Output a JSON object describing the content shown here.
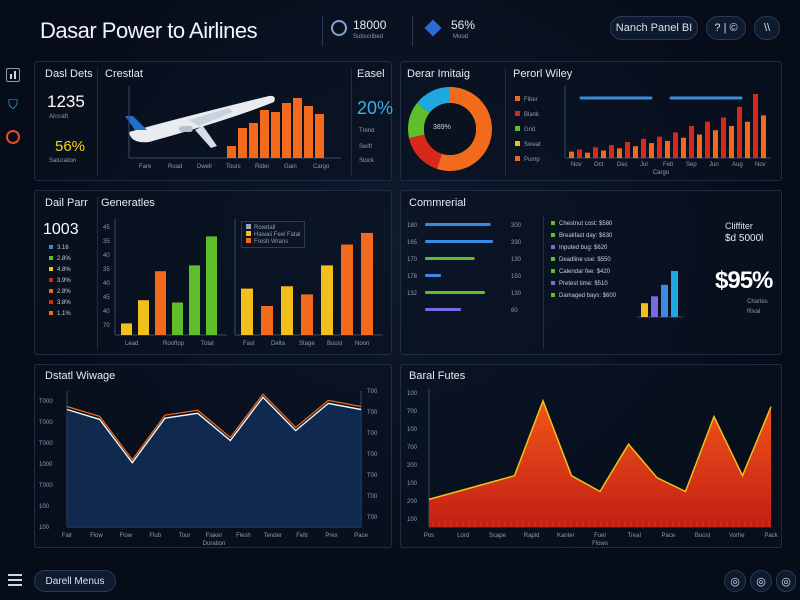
{
  "header": {
    "title": "Dasar Power to Airlines",
    "stat1": {
      "value": "18000",
      "label": "Subscribed"
    },
    "stat2": {
      "value": "56%",
      "label": "Mood"
    },
    "profile_button": "Nanch Panel BI",
    "help_button": "? | ©",
    "exit_button": "\\\\"
  },
  "sidebar": {
    "icons": [
      "chart-icon",
      "shield-icon",
      "gauge-icon"
    ],
    "bottom_icon": "menu-icon"
  },
  "panel_deal_dets": {
    "title": "Dasl Dets",
    "kpi1_value": "1235",
    "kpi1_label": "Aircraft",
    "kpi2_value": "56%",
    "kpi2_label": "Saturation",
    "chart_title": "Crestlat",
    "right_title": "Easel",
    "right_value": "20%",
    "right_items": [
      "Trend",
      "Swift",
      "Stock"
    ],
    "x_labels": [
      "Fare",
      "Road",
      "Dwell",
      "Tours",
      "Rider",
      "Gain",
      "Cargo"
    ]
  },
  "panel_donut": {
    "title": "Derar Imitaig",
    "center_value": "389%"
  },
  "panel_power": {
    "title": "Perorl Wiley",
    "legend": [
      "Fiber",
      "Blank",
      "Grid",
      "Sweat",
      "Pump"
    ],
    "x_labels": [
      "Nov",
      "Oct",
      "Dec",
      "Jul",
      "Feb",
      "Sep",
      "Jun",
      "Aug",
      "Nov"
    ],
    "axis_label": "Cargo"
  },
  "panel_dial_parr": {
    "title": "Dail Parr",
    "value": "1003",
    "items": [
      "3.16",
      "2.8%",
      "4.8%",
      "3.9%",
      "2.8%",
      "3.8%",
      "1.1%"
    ]
  },
  "panel_generators": {
    "title": "Generatles",
    "y_labels": [
      "45",
      "35",
      "40",
      "35",
      "40",
      "45",
      "40",
      "70"
    ],
    "x_labels": [
      "Lead",
      "Rooftop",
      "Total"
    ],
    "legend": [
      "Rowdall",
      "Hawaii Feel Fatal",
      "Fresh Wrans"
    ],
    "x_labels2": [
      "Fast",
      "Delta",
      "Stage",
      "Boost",
      "Noon"
    ]
  },
  "panel_commercial": {
    "title": "Commrerial",
    "bars_labels": [
      "180",
      "165",
      "170",
      "178",
      "132"
    ],
    "bar_values": [
      "300",
      "330",
      "130",
      "150",
      "130",
      "60"
    ],
    "list": [
      "Chestnut cost: $580",
      "Breakfast day: $630",
      "Inputed bug: $620",
      "Deadline use: $550",
      "Calendar fee: $420",
      "Pretest time: $510",
      "Damaged bays: $600"
    ],
    "value_label": "Cliffiter",
    "value_amount": "$d 5000l",
    "big_percent": "$95%",
    "big_sub1": "Charles",
    "big_sub2": "Rival"
  },
  "panel_wave": {
    "title": "Dstatl Wiwage",
    "y_left": [
      "T000",
      "T000",
      "T000",
      "1000",
      "T000",
      "100",
      "100"
    ],
    "y_right": [
      "T00",
      "T00",
      "T00",
      "T00",
      "T00",
      "T00",
      "T00"
    ],
    "x_labels": [
      "Fair",
      "Flow",
      "Flow",
      "Flub",
      "Tour",
      "Flaker",
      "Flesh",
      "Tender",
      "Feltr",
      "Prex",
      "Pace"
    ],
    "x_title": "Duration"
  },
  "panel_fuel": {
    "title": "Baral Futes",
    "y_labels": [
      "100",
      "700",
      "100",
      "700",
      "200",
      "100",
      "200",
      "100"
    ],
    "x_labels": [
      "Pos",
      "Lord",
      "Scape",
      "Rapid",
      "Kanter",
      "Fuel",
      "Treal",
      "Pace",
      "Boost",
      "Vorhe",
      "Pack"
    ],
    "x_title": "Flows"
  },
  "footer": {
    "menu_button": "Darell Menus"
  },
  "colors": {
    "orange": "#f26a1b",
    "yellow": "#f2c01b",
    "green": "#5fbf2a",
    "blue": "#3a8be0",
    "red": "#d8281c"
  },
  "chart_data": [
    {
      "type": "bar",
      "title": "Crestlat",
      "values": [
        12,
        30,
        35,
        48,
        46,
        55,
        60,
        52,
        44
      ]
    },
    {
      "type": "pie",
      "title": "Derar Imitaig",
      "values": [
        55,
        25,
        20
      ]
    },
    {
      "type": "bar",
      "title": "Perorl Wiley",
      "values": [
        6,
        8,
        5,
        10,
        7,
        12,
        9,
        15,
        11,
        18,
        14,
        20,
        16,
        24,
        19,
        30,
        22,
        34,
        26,
        38,
        30,
        48,
        34,
        60,
        40
      ]
    },
    {
      "type": "bar",
      "title": "Generatles",
      "series": [
        {
          "name": "",
          "values": [
            10,
            30,
            55,
            28,
            60,
            85
          ]
        },
        {
          "name": "",
          "values": [
            40,
            25,
            42,
            35,
            60,
            78,
            88
          ]
        }
      ]
    },
    {
      "type": "line",
      "title": "Dstatl Wiwage",
      "values": [
        950,
        870,
        520,
        880,
        920,
        700,
        1050,
        780,
        1000,
        950
      ]
    },
    {
      "type": "area",
      "title": "Baral Futes",
      "values": [
        140,
        180,
        220,
        260,
        640,
        260,
        180,
        420,
        250,
        180,
        560,
        260,
        610
      ]
    }
  ]
}
